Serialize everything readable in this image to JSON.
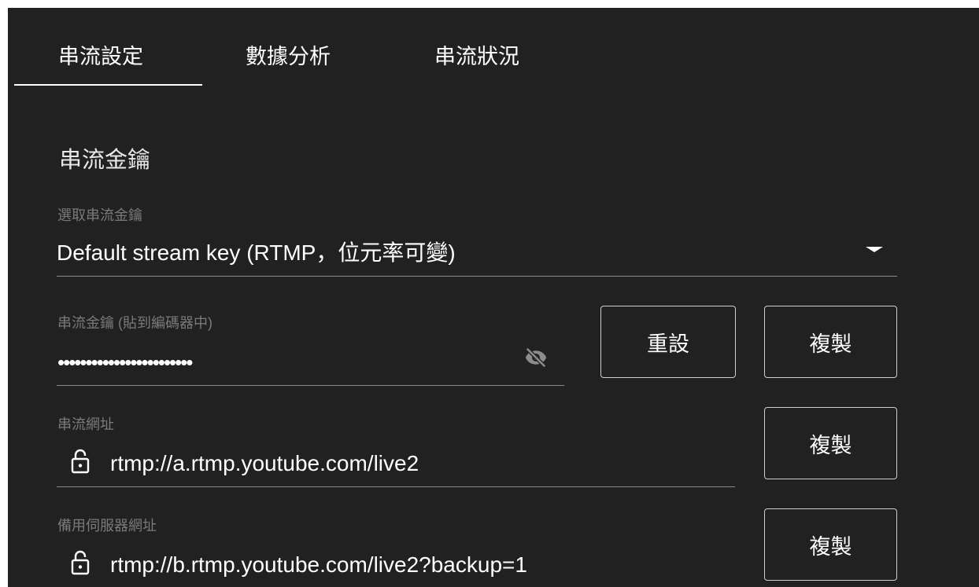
{
  "tabs": [
    {
      "label": "串流設定",
      "active": true
    },
    {
      "label": "數據分析",
      "active": false
    },
    {
      "label": "串流狀況",
      "active": false
    }
  ],
  "section_title": "串流金鑰",
  "stream_key_select": {
    "label": "選取串流金鑰",
    "value": "Default stream key (RTMP，位元率可變)"
  },
  "stream_key_field": {
    "label": "串流金鑰 (貼到編碼器中)",
    "value": "••••••••••••••••••••••••",
    "visibility_icon": "eye-off-icon",
    "reset_label": "重設",
    "copy_label": "複製"
  },
  "stream_url_field": {
    "label": "串流網址",
    "value": "rtmp://a.rtmp.youtube.com/live2",
    "icon": "lock-icon",
    "copy_label": "複製"
  },
  "backup_url_field": {
    "label": "備用伺服器網址",
    "value": "rtmp://b.rtmp.youtube.com/live2?backup=1",
    "icon": "lock-icon",
    "copy_label": "複製"
  },
  "colors": {
    "background": "#212121",
    "text": "#ffffff",
    "label": "#7a7a7a"
  }
}
